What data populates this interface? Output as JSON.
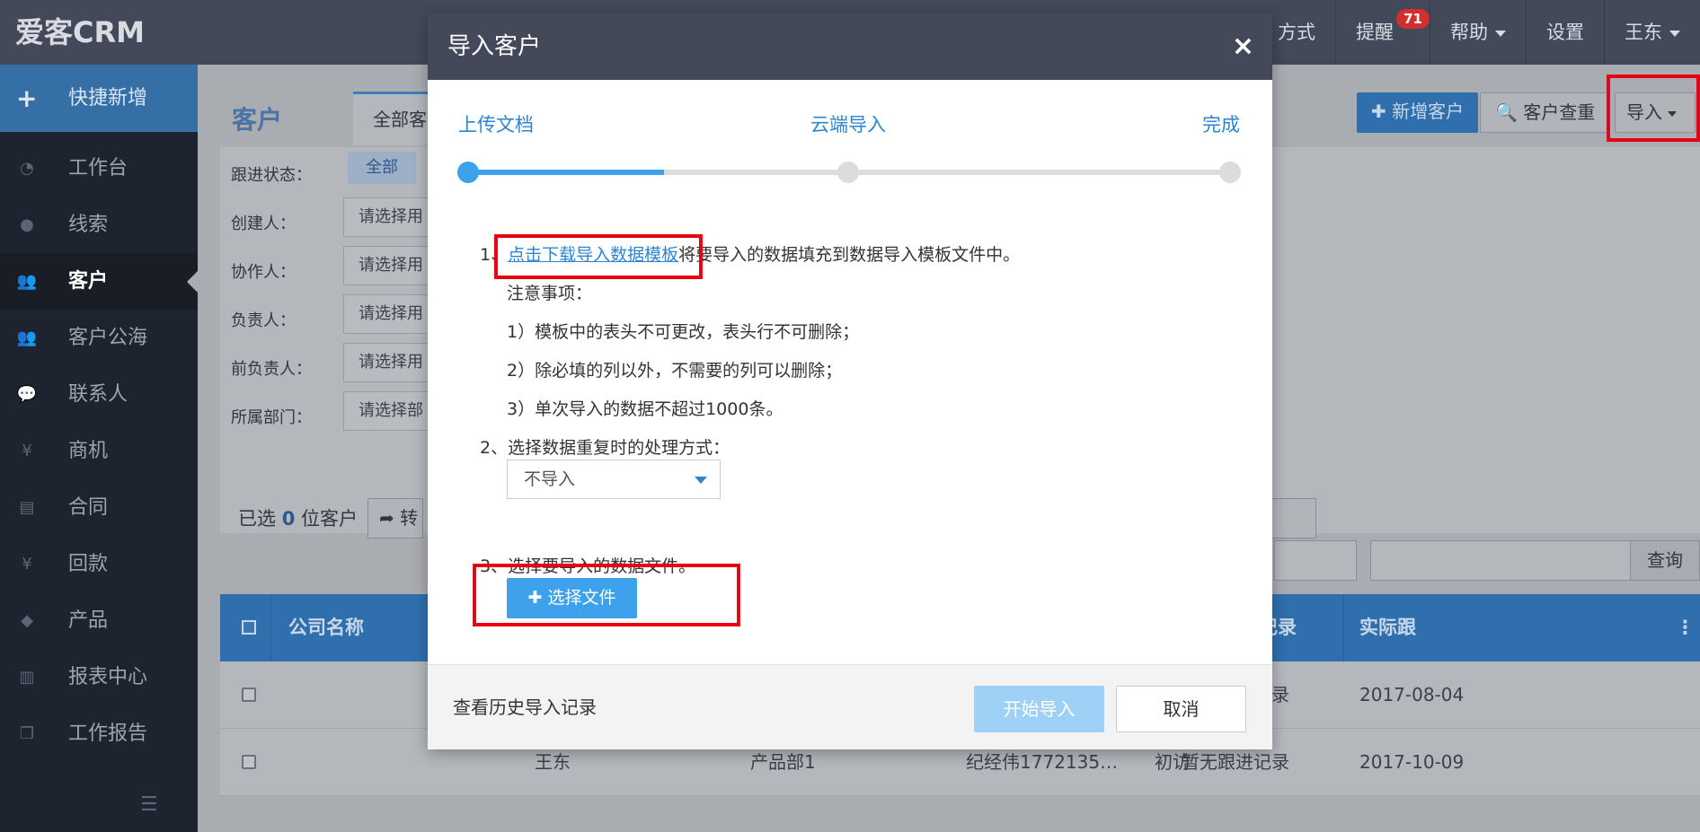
{
  "app": {
    "logo": "爱客CRM"
  },
  "topnav": {
    "partial": "方式",
    "remind": "提醒",
    "remind_badge": "71",
    "help": "帮助",
    "settings": "设置",
    "user": "王东"
  },
  "sidebar": {
    "quick_add": "快捷新增",
    "items": [
      {
        "label": "工作台",
        "icon": "dashboard-icon"
      },
      {
        "label": "线索",
        "icon": "globe-icon"
      },
      {
        "label": "客户",
        "icon": "users-icon"
      },
      {
        "label": "客户公海",
        "icon": "users-icon"
      },
      {
        "label": "联系人",
        "icon": "chat-icon"
      },
      {
        "label": "商机",
        "icon": "yen-icon"
      },
      {
        "label": "合同",
        "icon": "document-icon"
      },
      {
        "label": "回款",
        "icon": "yen-icon"
      },
      {
        "label": "产品",
        "icon": "tags-icon"
      },
      {
        "label": "报表中心",
        "icon": "bar-chart-icon"
      },
      {
        "label": "工作报告",
        "icon": "copy-icon"
      }
    ],
    "active": "客户"
  },
  "main": {
    "title": "客户",
    "tab_all": "全部客",
    "btn_new": "新增客户",
    "btn_dedupe": "客户查重",
    "btn_import": "导入",
    "filters": {
      "status_label": "跟进状态：",
      "status_all": "全部",
      "creator_label": "创建人：",
      "collab_label": "协作人：",
      "owner_label": "负责人：",
      "prev_owner_label": "前负责人：",
      "dept_label": "所属部门：",
      "placeholder_user": "请选择用",
      "placeholder_dept": "请选择部"
    },
    "selected_prefix": "已选",
    "selected_count": "0",
    "selected_suffix": "位客户",
    "transfer": "转",
    "search_btn": "查询",
    "table": {
      "headers": {
        "company": "公司名称",
        "latest": "最新跟进记录",
        "actual": "实际跟"
      },
      "rows": [
        {
          "owner": "",
          "dept": "",
          "contact": "",
          "stage": "",
          "latest": "暂无跟进记录",
          "date": "2017-08-04"
        },
        {
          "owner": "王东",
          "dept": "产品部1",
          "contact": "纪经伟1772135…",
          "stage": "初访",
          "latest": "暂无跟进记录",
          "date": "2017-10-09"
        }
      ]
    }
  },
  "modal": {
    "title": "导入客户",
    "steps": [
      "上传文档",
      "云端导入",
      "完成"
    ],
    "step1_prefix": "1、",
    "step1_link": "点击下载导入数据模板",
    "step1_rest": "将要导入的数据填充到数据导入模板文件中。",
    "notes_title": "注意事项：",
    "note1": "1）模板中的表头不可更改，表头行不可删除；",
    "note2": "2）除必填的列以外，不需要的列可以删除；",
    "note3": "3）单次导入的数据不超过1000条。",
    "step2": "2、选择数据重复时的处理方式：",
    "dup_option": "不导入",
    "step3": "3、选择要导入的数据文件。",
    "choose_file": "选择文件",
    "history": "查看历史导入记录",
    "start": "开始导入",
    "cancel": "取消"
  }
}
